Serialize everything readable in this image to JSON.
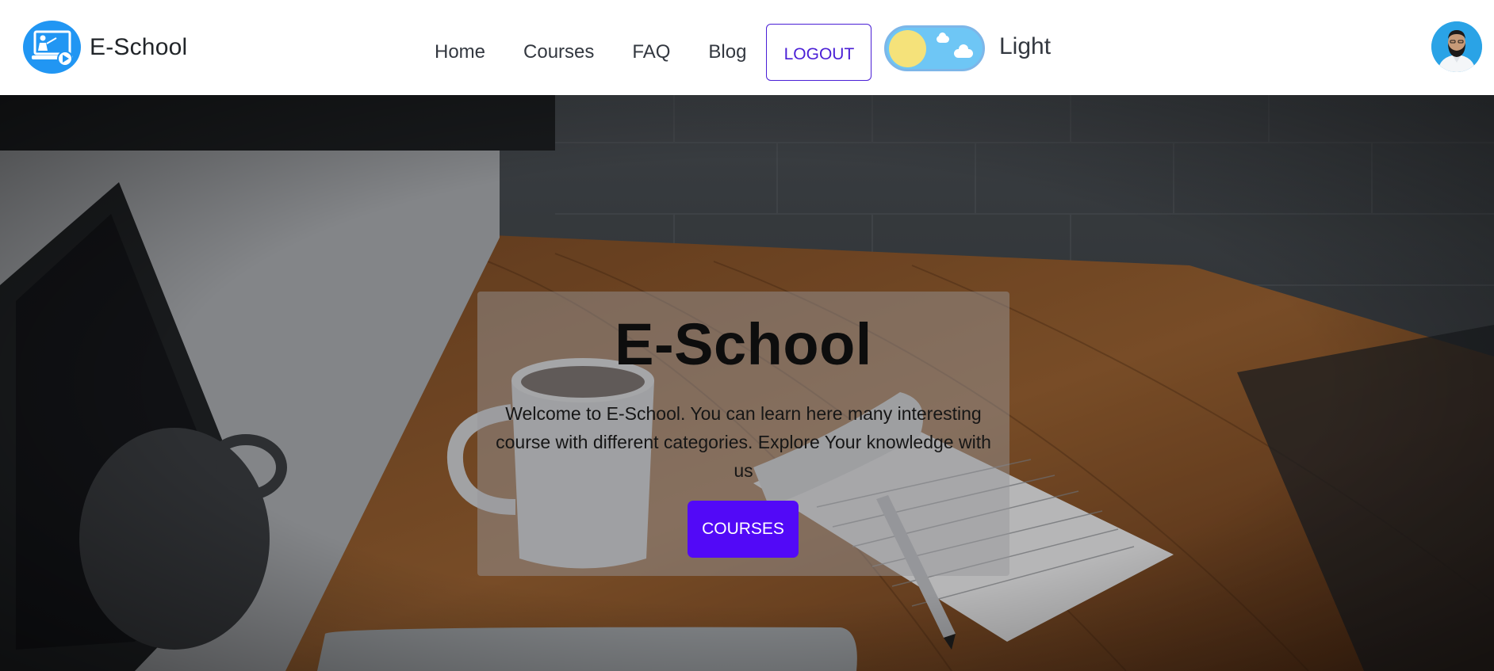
{
  "brand": {
    "name": "E-School",
    "logo_icon": "teacher-screen-icon",
    "logo_color": "#2196f3"
  },
  "nav": {
    "links": [
      "Home",
      "Courses",
      "FAQ",
      "Blog"
    ],
    "logout_label": "LOGOUT",
    "accent_color": "#4a1fd6"
  },
  "theme_toggle": {
    "label": "Light",
    "state": "light",
    "knob_color": "#f5e27a",
    "track_color": "#6ec6f5"
  },
  "user": {
    "avatar_icon": "user-avatar-icon"
  },
  "hero": {
    "title": "E-School",
    "description": "Welcome to E-School. You can learn here many interesting course with different categories. Explore Your knowledge with us",
    "cta_label": "COURSES",
    "cta_color": "#5209f7",
    "background": "desk-photo-laptop-coffee-notepad"
  }
}
